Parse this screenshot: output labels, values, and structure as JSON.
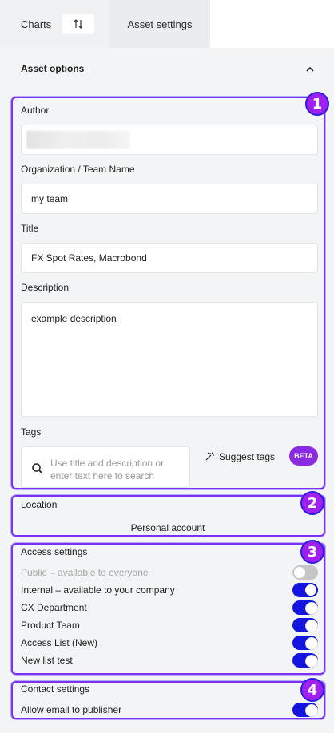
{
  "tabs": {
    "charts_label": "Charts",
    "asset_settings_label": "Asset settings"
  },
  "asset_options": {
    "header": "Asset options",
    "author": {
      "label": "Author",
      "value": ""
    },
    "organization": {
      "label": "Organization / Team Name",
      "value": "my team"
    },
    "title": {
      "label": "Title",
      "value": "FX Spot Rates, Macrobond"
    },
    "description": {
      "label": "Description",
      "value": "example description"
    },
    "tags": {
      "label": "Tags",
      "placeholder": "Use title and description or enter text here to search",
      "suggest_label": "Suggest tags",
      "beta_badge": "BETA"
    }
  },
  "location": {
    "label": "Location",
    "value": "Personal account"
  },
  "access_settings": {
    "label": "Access settings",
    "items": [
      {
        "label": "Public – available to everyone",
        "enabled": false,
        "disabled": true
      },
      {
        "label": "Internal – available to your company",
        "enabled": true
      },
      {
        "label": "CX Department",
        "enabled": true
      },
      {
        "label": "Product Team",
        "enabled": true
      },
      {
        "label": "Access List (New)",
        "enabled": true
      },
      {
        "label": "New list test",
        "enabled": true
      }
    ]
  },
  "contact_settings": {
    "label": "Contact settings",
    "items": [
      {
        "label": "Allow email to publisher",
        "enabled": true
      }
    ]
  },
  "badges": [
    "1",
    "2",
    "3",
    "4"
  ],
  "colors": {
    "accent": "#1515e0",
    "highlight_frame": "#7b2ff7",
    "badge": "#a020f0",
    "beta": "#8a2be2"
  }
}
